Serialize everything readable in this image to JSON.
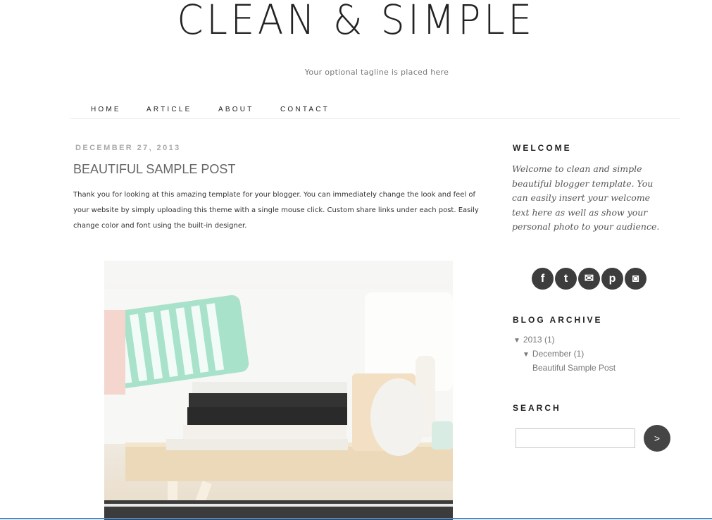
{
  "header": {
    "title": "CLEAN & SIMPLE",
    "tagline": "Your optional tagline is placed here"
  },
  "nav": {
    "items": [
      {
        "label": "HOME"
      },
      {
        "label": "ARTICLE"
      },
      {
        "label": "ABOUT"
      },
      {
        "label": "CONTACT"
      }
    ]
  },
  "post": {
    "date": "DECEMBER 27, 2013",
    "title": "BEAUTIFUL SAMPLE POST",
    "body": "Thank you for looking at this amazing template for your blogger. You can immediately change the look and feel of your website by simply uploading this theme with a single mouse click. Custom share links under each post. Easily change color and font using the built-in designer.",
    "image_icon": "photo-books-vase-icon"
  },
  "sidebar": {
    "welcome": {
      "heading": "WELCOME",
      "text": "Welcome to clean and simple beautiful blogger template. You can easily insert your welcome text here as well as show your personal photo to your audience."
    },
    "social": [
      {
        "icon": "facebook-icon",
        "glyph": "f"
      },
      {
        "icon": "twitter-icon",
        "glyph": "t"
      },
      {
        "icon": "email-icon",
        "glyph": "✉"
      },
      {
        "icon": "pinterest-icon",
        "glyph": "p"
      },
      {
        "icon": "instagram-icon",
        "glyph": "◙"
      }
    ],
    "archive": {
      "heading": "BLOG ARCHIVE",
      "year": "2013",
      "year_count": "(1)",
      "month": "December",
      "month_count": "(1)",
      "post": "Beautiful Sample Post",
      "toggle_glyph": "▼"
    },
    "search": {
      "heading": "SEARCH",
      "button_label": ">"
    }
  },
  "colors": {
    "accent_line": "#4b86c9",
    "button_bg": "#454545"
  }
}
